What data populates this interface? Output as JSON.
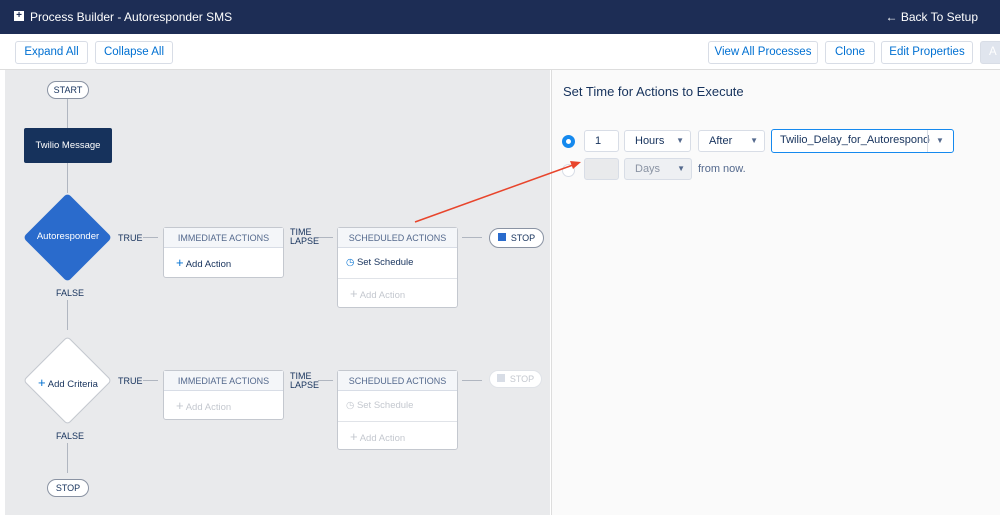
{
  "header": {
    "title": "Process Builder - Autoresponder SMS",
    "back_label": "Back To Setup"
  },
  "toolbar": {
    "expand_all": "Expand All",
    "collapse_all": "Collapse All",
    "view_all": "View All Processes",
    "clone": "Clone",
    "edit_properties": "Edit Properties",
    "activate": "A"
  },
  "canvas": {
    "start": "START",
    "stop": "STOP",
    "message": "Twilio Message",
    "criteria1": "Autoresponder",
    "add_criteria": "Add Criteria",
    "true_label": "TRUE",
    "false_label": "FALSE",
    "time_lapse": "TIME LAPSE",
    "immediate": "IMMEDIATE ACTIONS",
    "scheduled": "SCHEDULED ACTIONS",
    "add_action": "Add Action",
    "set_schedule": "Set Schedule"
  },
  "panel": {
    "title": "Set Time for Actions to Execute",
    "row1": {
      "selected": true,
      "amount": "1",
      "unit": "Hours",
      "relation": "After",
      "field": "Twilio_Delay_for_Autoresponde"
    },
    "row2": {
      "selected": false,
      "amount": "",
      "unit": "Days",
      "suffix": "from now."
    }
  },
  "colors": {
    "header": "#1d2d55",
    "brand_blue": "#0070d2",
    "criteria": "#2a6bcc",
    "annotation_arrow": "#e8452c"
  }
}
